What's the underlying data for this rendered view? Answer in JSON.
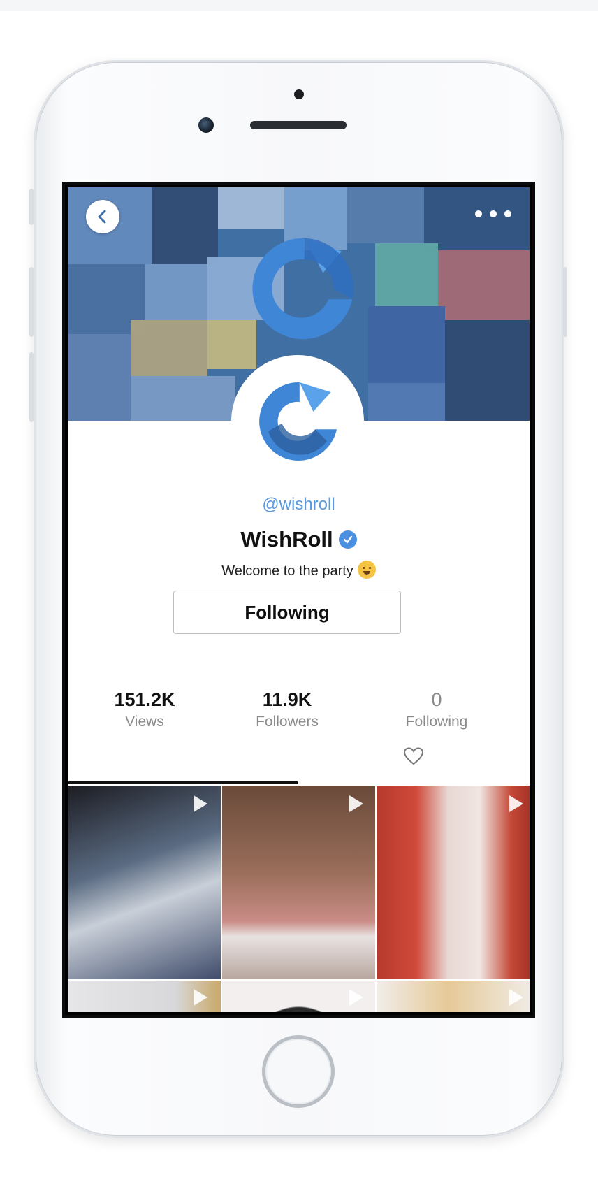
{
  "profile": {
    "handle": "@wishroll",
    "name": "WishRoll",
    "bio": "Welcome to the party",
    "bio_emoji": "partying-face",
    "verified": true,
    "follow_button_label": "Following"
  },
  "stats": [
    {
      "value": "151.2K",
      "label": "Views"
    },
    {
      "value": "11.9K",
      "label": "Followers"
    },
    {
      "value": "0",
      "label": "Following"
    }
  ],
  "tabs": {
    "active": "videos",
    "secondary_icon": "heart-icon"
  },
  "icons": {
    "back": "chevron-left-icon",
    "more": "more-dots-icon",
    "play": "play-icon"
  },
  "colors": {
    "accent_blue": "#4a8fe0",
    "handle_blue": "#5a9ae0",
    "banner_tint": "#3f6d9c"
  },
  "videos": [
    {
      "id": "v1"
    },
    {
      "id": "v2"
    },
    {
      "id": "v3"
    },
    {
      "id": "v4"
    },
    {
      "id": "v5"
    },
    {
      "id": "v6"
    }
  ]
}
